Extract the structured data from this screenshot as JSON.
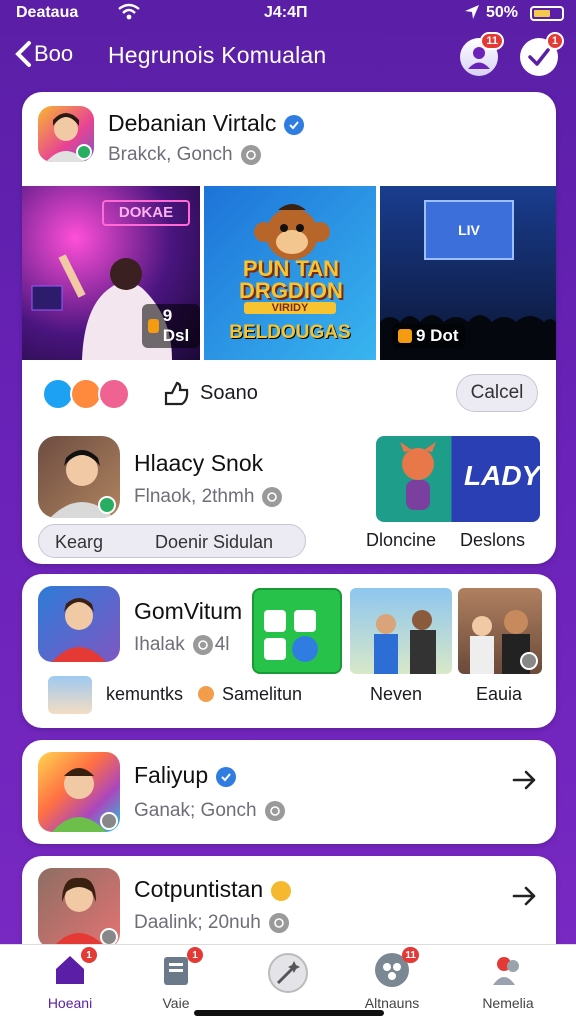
{
  "status": {
    "carrier": "Deatauа",
    "time": "J4:4П",
    "battery": "50%"
  },
  "header": {
    "back_label": "Boo",
    "title": "Hegrunois Komualan",
    "profile_badge": "11",
    "check_badge": "1"
  },
  "card1": {
    "name": "Debanian Virtalc",
    "subtitle": "Brakck, Gonch",
    "media": [
      {
        "label": "DOKAE",
        "caption": "9 Dsl"
      },
      {
        "title": "PUN TAN DRGDION",
        "banner": "VIRIDY",
        "caption": "BELDOUGAS"
      },
      {
        "label": "LIV",
        "caption": "9 Dot"
      }
    ],
    "reactions_label": "Soano",
    "cancel_label": "Calcel"
  },
  "card1b": {
    "name": "Hlaacy Snok",
    "subtitle": "Flnaok, 2thmh",
    "pill_left": "Kearg",
    "pill_right": "Doenir Sidulan",
    "promo_text": "LADY",
    "caption_a": "Dloncine",
    "caption_b": "Deslons"
  },
  "card2": {
    "name": "GomVitum",
    "subtitle": "Ihalak",
    "badge_text": "4l",
    "footer_text_a": "kemuntks",
    "footer_text_b": "Samelitun",
    "caption_a": "Neven",
    "caption_b": "Eauia"
  },
  "card3": {
    "name": "Faliyup",
    "subtitle": "Ganak; Gonch"
  },
  "card4": {
    "name": "Cotpuntistan",
    "subtitle": "Daalink; 20nuh"
  },
  "nav": [
    {
      "label": "Hoeani",
      "badge": "1"
    },
    {
      "label": "Vaie",
      "badge": "1"
    },
    {
      "label": ""
    },
    {
      "label": "Altnauns",
      "badge": "11"
    },
    {
      "label": "Nemelia"
    }
  ],
  "colors": {
    "accent": "#6a22b8",
    "verify": "#2f7de1",
    "badge": "#e53935"
  }
}
